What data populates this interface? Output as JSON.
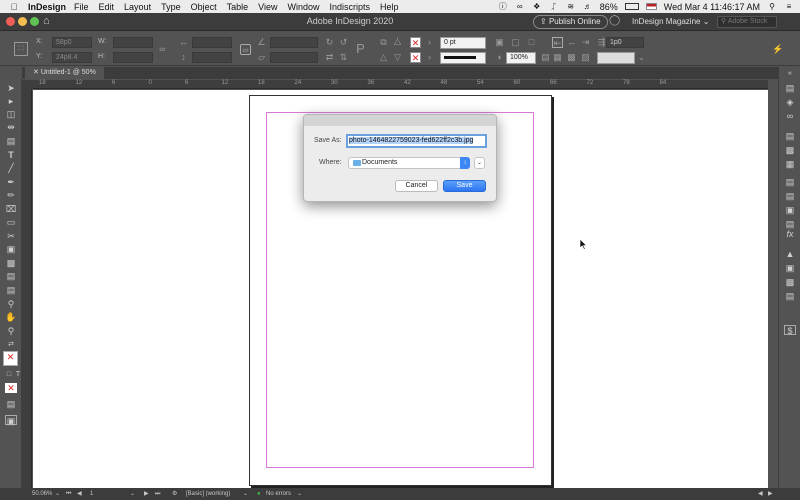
{
  "menubar": {
    "app_name": "InDesign",
    "menus": [
      "File",
      "Edit",
      "Layout",
      "Type",
      "Object",
      "Table",
      "View",
      "Window",
      "Indiscripts",
      "Help"
    ],
    "battery": "86%",
    "clock": "Wed Mar 4  11:46:17 AM"
  },
  "appbar": {
    "title": "Adobe InDesign 2020",
    "publish_label": "Publish Online",
    "workspace_label": "InDesign Magazine",
    "stock_search_placeholder": "Adobe Stock"
  },
  "control": {
    "x_label": "X:",
    "x_value": "58p0",
    "y_label": "Y:",
    "y_value": "24p8.4",
    "w_label": "W:",
    "h_label": "H:",
    "stroke_weight": "0 pt",
    "zoom": "100%",
    "gap_value": "1p0"
  },
  "document": {
    "tab_label": "Untitled-1 @ 50%",
    "ruler_ticks": [
      "18",
      "12",
      "6",
      "0",
      "6",
      "12",
      "18",
      "24",
      "30",
      "36",
      "42",
      "48",
      "54",
      "60",
      "66",
      "72",
      "78",
      "84"
    ]
  },
  "dialog": {
    "save_as_label": "Save As:",
    "filename": "photo-1464822759023-fed622ff2c3b.jpg",
    "where_label": "Where:",
    "where_value": "Documents",
    "cancel_label": "Cancel",
    "save_label": "Save"
  },
  "statusbar": {
    "zoom": "50.06%",
    "page": "1",
    "preflight_profile": "[Basic] (working)",
    "error_status": "No errors"
  },
  "colors": {
    "accent": "#2d76f0",
    "margin_guide": "#d97ad9",
    "ui_dark": "#535353"
  }
}
